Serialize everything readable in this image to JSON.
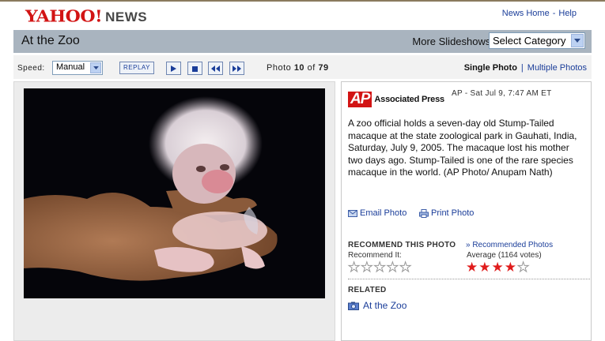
{
  "logo": {
    "yahoo": "YAHOO!",
    "news": "NEWS"
  },
  "top_links": {
    "news_home": "News Home",
    "separator": "-",
    "help": "Help"
  },
  "title_bar": {
    "title": "At the Zoo",
    "more_slideshows_label": "More Slideshows:",
    "category_select_value": "Select Category"
  },
  "controls": {
    "speed_label": "Speed:",
    "speed_value": "Manual",
    "replay_label": "REPLAY",
    "photo_prefix": "Photo",
    "photo_current": "10",
    "photo_of": "of",
    "photo_total": "79",
    "single_photo": "Single Photo",
    "separator": "|",
    "multiple_photos": "Multiple Photos"
  },
  "info": {
    "ap_logo": "AP",
    "ap_name": "Associated Press",
    "dateline": "AP - Sat Jul 9, 7:47 AM ET",
    "caption": "A zoo official holds a seven-day old Stump-Tailed macaque at the state zoological park in Gauhati, India, Saturday, July 9, 2005. The macaque lost his mother two days ago. Stump-Tailed is one of the rare species macaque in the world. (AP Photo/ Anupam Nath)",
    "email_photo": "Email Photo",
    "print_photo": "Print Photo",
    "recommend_heading": "RECOMMEND THIS PHOTO",
    "recommended_link": "» Recommended Photos",
    "recommend_it": "Recommend It:",
    "average_label": "Average (1164 votes)",
    "average_rating": 4,
    "rating_max": 5,
    "related_heading": "RELATED",
    "related_item": "At the Zoo"
  },
  "colors": {
    "yahoo_red": "#d21414",
    "link_blue": "#1a3d99",
    "title_bar": "#a9b4bf"
  }
}
